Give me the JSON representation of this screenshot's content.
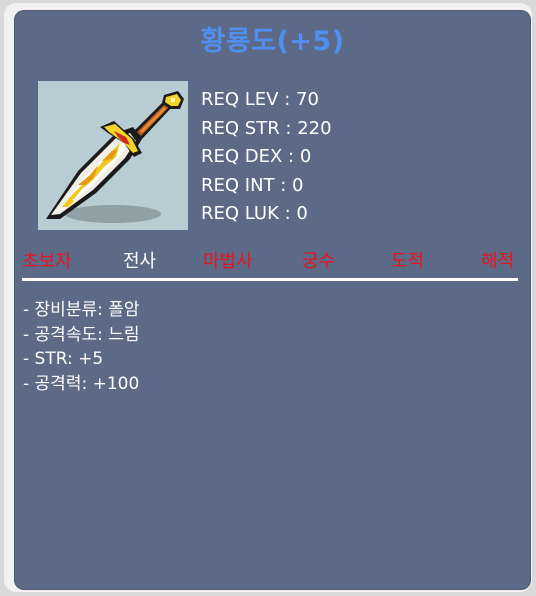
{
  "item": {
    "name": "황룡도(+5)",
    "name_color": "#4f8ff0",
    "icon": "golden-dragon-sword-icon"
  },
  "requirements": [
    {
      "label": "REQ LEV : 70"
    },
    {
      "label": "REQ STR : 220"
    },
    {
      "label": "REQ DEX : 0"
    },
    {
      "label": "REQ INT : 0"
    },
    {
      "label": "REQ LUK : 0"
    }
  ],
  "jobs": [
    {
      "label": "초보자",
      "color": "#e8141e"
    },
    {
      "label": "전사",
      "color": "#ffffff"
    },
    {
      "label": "마법사",
      "color": "#e8141e"
    },
    {
      "label": "궁수",
      "color": "#e8141e"
    },
    {
      "label": "도적",
      "color": "#e8141e"
    },
    {
      "label": "해적",
      "color": "#e8141e"
    }
  ],
  "stats": [
    {
      "label": "- 장비분류: 폴암"
    },
    {
      "label": "- 공격속도: 느림"
    },
    {
      "label": "- STR: +5"
    },
    {
      "label": "- 공격력: +100"
    }
  ],
  "colors": {
    "panel": "#5c6a87",
    "available_job": "#ffffff",
    "unavailable_job": "#e8141e"
  }
}
